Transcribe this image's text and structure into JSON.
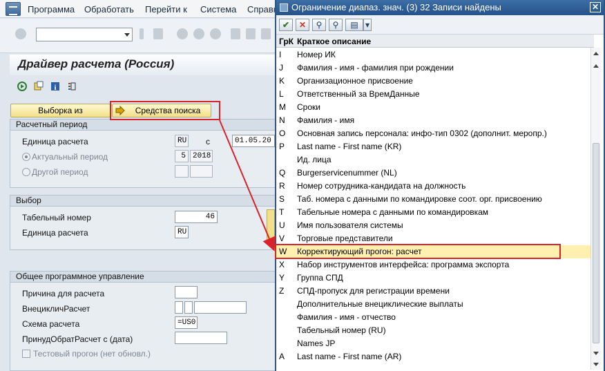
{
  "menubar": {
    "items": [
      "Программа",
      "Обработать",
      "Перейти к",
      "Система",
      "Справк"
    ]
  },
  "main": {
    "title": "Драйвер расчета (Россия)",
    "buttons": {
      "selection_from": "Выборка из",
      "search_tools": "Средства поиска"
    },
    "period_group": {
      "title": "Расчетный период",
      "unit_label": "Единица расчета",
      "unit_value": "RU",
      "from_label": "с",
      "date_value": "01.05.20",
      "current_period_label": "Актуальный период",
      "period_num": "5",
      "period_year": "2018",
      "other_period_label": "Другой период"
    },
    "selection_group": {
      "title": "Выбор",
      "personnel_label": "Табельный номер",
      "personnel_value": "46",
      "unit_label": "Единица расчета",
      "unit_value": "RU"
    },
    "control_group": {
      "title": "Общее программное управление",
      "reason_label": "Причина для расчета",
      "offcycle_label": "ВнецикличРасчет",
      "schema_label": "Схема расчета",
      "schema_value": "=US0",
      "forced_label": "ПринудОбратРасчет с (дата)",
      "test_label": "Тестовый прогон (нет обновл.)"
    }
  },
  "popup": {
    "title": "Ограничение диапаз. знач. (3)   32 Записи найдены",
    "close": "✕",
    "col_group": "ГрК",
    "col_desc": "Краткое описание",
    "rows": [
      {
        "k": "I",
        "d": "Номер ИК"
      },
      {
        "k": "J",
        "d": "Фамилия - имя - фамилия при рождении"
      },
      {
        "k": "K",
        "d": "Организационное присвоение"
      },
      {
        "k": "L",
        "d": "Ответственный за ВремДанные"
      },
      {
        "k": "M",
        "d": "Сроки"
      },
      {
        "k": "N",
        "d": "Фамилия  - имя"
      },
      {
        "k": "O",
        "d": "Основная запись персонала: инфо-тип 0302 (дополнит. меропр.)"
      },
      {
        "k": "P",
        "d": "Last name - First name (KR)"
      },
      {
        "k": "",
        "d": "Ид. лица"
      },
      {
        "k": "Q",
        "d": "Burgerservicenummer (NL)"
      },
      {
        "k": "R",
        "d": "Номер сотрудника-кандидата на должность"
      },
      {
        "k": "S",
        "d": "Таб. номера с данными по командировке соот. орг. присвоению"
      },
      {
        "k": "T",
        "d": "Табельные номера с данными по командировкам"
      },
      {
        "k": "U",
        "d": "Имя пользователя системы"
      },
      {
        "k": "V",
        "d": "Торговые представители"
      },
      {
        "k": "W",
        "d": "Корректирующий прогон: расчет"
      },
      {
        "k": "X",
        "d": "Набор инструментов интерфейса: программа экспорта"
      },
      {
        "k": "Y",
        "d": "Группа СПД"
      },
      {
        "k": "Z",
        "d": "СПД-пропуск для регистрации времени"
      },
      {
        "k": "",
        "d": "Дополнительные внециклические выплаты"
      },
      {
        "k": "",
        "d": "Фамилия - имя - отчество"
      },
      {
        "k": "",
        "d": "Табельный номер (RU)"
      },
      {
        "k": "",
        "d": "Names JP"
      },
      {
        "k": "A",
        "d": "Last name - First name (AR)"
      }
    ]
  },
  "colors": {
    "highlight": "#d9232b",
    "title_bar": "#2f5581",
    "button_yellow": "#f3e08a"
  }
}
